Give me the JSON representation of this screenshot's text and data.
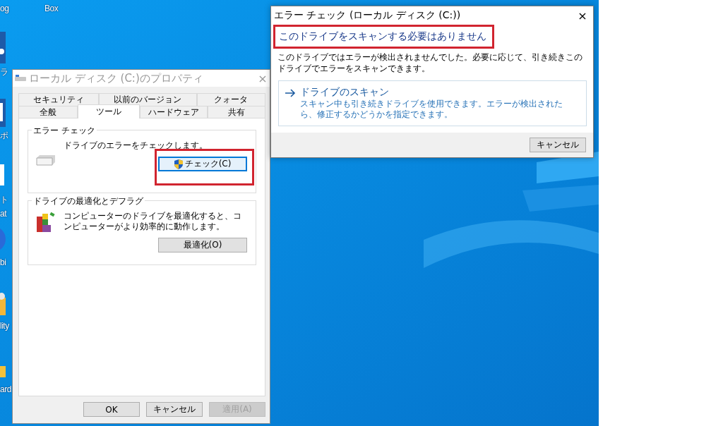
{
  "desktop": {
    "icon_labels": [
      {
        "text": "og"
      },
      {
        "text": "Box"
      },
      {
        "text": "ラ"
      },
      {
        "text": "ポ"
      },
      {
        "text": "ト"
      },
      {
        "text": "at"
      },
      {
        "text": "bi"
      },
      {
        "text": "lity"
      },
      {
        "text": "ard"
      }
    ]
  },
  "properties_window": {
    "title": "ローカル ディスク (C:)のプロパティ",
    "close": "×",
    "tab_rows": [
      [
        {
          "label": "セキュリティ",
          "selected": false
        },
        {
          "label": "以前のバージョン",
          "selected": false
        },
        {
          "label": "クォータ",
          "selected": false
        }
      ],
      [
        {
          "label": "全般",
          "selected": false
        },
        {
          "label": "ツール",
          "selected": true
        },
        {
          "label": "ハードウェア",
          "selected": false
        },
        {
          "label": "共有",
          "selected": false
        }
      ]
    ],
    "groups": [
      {
        "kind": "error_check",
        "title": "エラー チェック",
        "text": "ドライブのエラーをチェックします。",
        "button": {
          "label": "チェック(C)",
          "highlighted": true
        }
      },
      {
        "kind": "optimize",
        "title": "ドライブの最適化とデフラグ",
        "text": "コンピューターのドライブを最適化すると、コンピューターがより効率的に動作します。",
        "button": {
          "label": "最適化(O)"
        }
      }
    ],
    "buttons": [
      {
        "label": "OK",
        "disabled": false
      },
      {
        "label": "キャンセル",
        "disabled": false
      },
      {
        "label": "適用(A)",
        "disabled": true
      }
    ]
  },
  "error_check_dialog": {
    "title": "エラー チェック (ローカル ディスク (C:))",
    "close": "×",
    "heading": "このドライブをスキャンする必要はありません",
    "heading_highlighted": true,
    "message": "このドライブではエラーが検出されませんでした。必要に応じて、引き続きこのドライブでエラーをスキャンできます。",
    "option": {
      "title": "ドライブのスキャン",
      "description": "スキャン中も引き続きドライブを使用できます。エラーが検出されたら、修正するかどうかを指定できます。"
    },
    "buttons": [
      {
        "label": "キャンセル",
        "disabled": false
      }
    ]
  }
}
